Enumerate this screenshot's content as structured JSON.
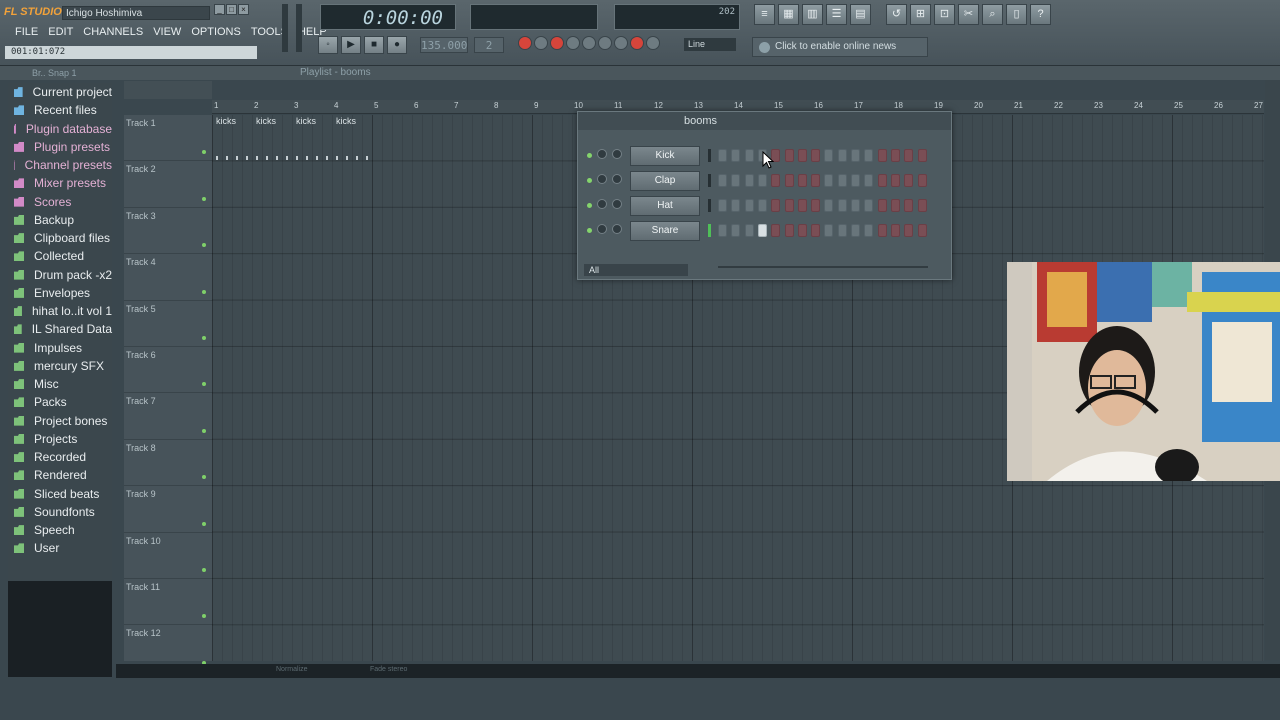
{
  "app": {
    "title": "Ichigo Hoshimiva",
    "logo": "FL STUDIO",
    "hint": "001:01:072"
  },
  "menu": [
    "FILE",
    "EDIT",
    "CHANNELS",
    "VIEW",
    "OPTIONS",
    "TOOLS",
    "HELP"
  ],
  "transport": {
    "time": "0:00:00",
    "tempo": "135.000",
    "pattern": "2",
    "snap": "Line",
    "cpu": "202"
  },
  "news": "Click to enable online news",
  "browser": {
    "header": "Br.. Snap 1",
    "items": [
      {
        "label": "Current project",
        "kind": "project"
      },
      {
        "label": "Recent files",
        "kind": "recent"
      },
      {
        "label": "Plugin database",
        "kind": "pink"
      },
      {
        "label": "Plugin presets",
        "kind": "pink"
      },
      {
        "label": "Channel presets",
        "kind": "pink"
      },
      {
        "label": "Mixer presets",
        "kind": "pink"
      },
      {
        "label": "Scores",
        "kind": "pink"
      },
      {
        "label": "Backup",
        "kind": "folder"
      },
      {
        "label": "Clipboard files",
        "kind": "folder"
      },
      {
        "label": "Collected",
        "kind": "folder"
      },
      {
        "label": "Drum pack -x2",
        "kind": "folder"
      },
      {
        "label": "Envelopes",
        "kind": "folder"
      },
      {
        "label": "hihat lo..it vol 1",
        "kind": "folder"
      },
      {
        "label": "IL Shared Data",
        "kind": "folder"
      },
      {
        "label": "Impulses",
        "kind": "folder"
      },
      {
        "label": "mercury SFX",
        "kind": "folder"
      },
      {
        "label": "Misc",
        "kind": "folder"
      },
      {
        "label": "Packs",
        "kind": "folder"
      },
      {
        "label": "Project bones",
        "kind": "folder"
      },
      {
        "label": "Projects",
        "kind": "folder"
      },
      {
        "label": "Recorded",
        "kind": "folder"
      },
      {
        "label": "Rendered",
        "kind": "folder"
      },
      {
        "label": "Sliced beats",
        "kind": "folder"
      },
      {
        "label": "Soundfonts",
        "kind": "folder"
      },
      {
        "label": "Speech",
        "kind": "folder"
      },
      {
        "label": "User",
        "kind": "folder"
      }
    ]
  },
  "playlist": {
    "title": "Playlist - booms",
    "bars": [
      "1",
      "2",
      "3",
      "4",
      "5",
      "6",
      "7",
      "8",
      "9",
      "10",
      "11",
      "12",
      "13",
      "14",
      "15",
      "16",
      "17",
      "18",
      "19",
      "20",
      "21",
      "22",
      "23",
      "24",
      "25",
      "26",
      "27"
    ],
    "tracks": [
      "Track 1",
      "Track 2",
      "Track 3",
      "Track 4",
      "Track 5",
      "Track 6",
      "Track 7",
      "Track 8",
      "Track 9",
      "Track 10",
      "Track 11",
      "Track 12"
    ],
    "clips": [
      "kicks",
      "kicks",
      "kicks",
      "kicks"
    ],
    "footer": [
      "Normalize",
      "Fade stereo"
    ]
  },
  "sequencer": {
    "pattern": "booms",
    "filter": "All",
    "channels": [
      {
        "name": "Kick",
        "steps": [
          0,
          0,
          0,
          0,
          0,
          0,
          0,
          0,
          0,
          0,
          0,
          0,
          0,
          0,
          0,
          0
        ]
      },
      {
        "name": "Clap",
        "steps": [
          0,
          0,
          0,
          0,
          0,
          0,
          0,
          0,
          0,
          0,
          0,
          0,
          0,
          0,
          0,
          0
        ]
      },
      {
        "name": "Hat",
        "steps": [
          0,
          0,
          0,
          0,
          0,
          0,
          0,
          0,
          0,
          0,
          0,
          0,
          0,
          0,
          0,
          0
        ]
      },
      {
        "name": "Snare",
        "steps": [
          0,
          0,
          0,
          1,
          0,
          0,
          0,
          0,
          0,
          0,
          0,
          0,
          0,
          0,
          0,
          0
        ]
      }
    ]
  },
  "colors": {
    "accent": "#f2a23a",
    "step_red": "#7a4e55",
    "step_grey": "#68757b",
    "led": "#84d46c"
  }
}
